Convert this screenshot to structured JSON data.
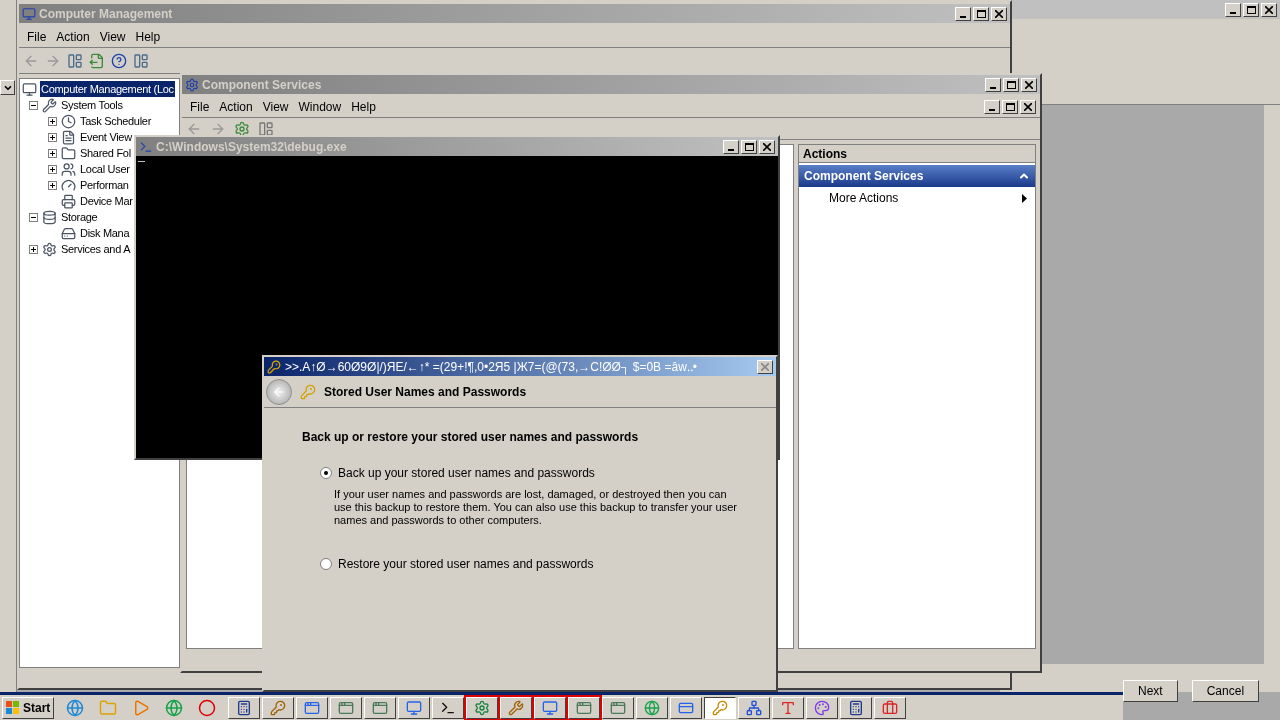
{
  "computer_management": {
    "title": "Computer Management",
    "menu": [
      "File",
      "Action",
      "View",
      "Help"
    ],
    "tree": [
      {
        "label": "Computer Management (Loc",
        "kind": "computer",
        "selected": true,
        "children": [
          {
            "label": "System Tools",
            "kind": "tools",
            "expanded": true,
            "selected": false,
            "children": [
              {
                "label": "Task Scheduler",
                "kind": "clock",
                "expanded": false,
                "selected": false
              },
              {
                "label": "Event View",
                "kind": "log",
                "expanded": false,
                "selected": false
              },
              {
                "label": "Shared Fol",
                "kind": "folder",
                "expanded": false,
                "selected": false
              },
              {
                "label": "Local User",
                "kind": "users",
                "expanded": false,
                "selected": false
              },
              {
                "label": "Performan",
                "kind": "gauge",
                "expanded": false,
                "selected": false
              },
              {
                "label": "Device Mar",
                "kind": "device",
                "selected": false
              }
            ]
          },
          {
            "label": "Storage",
            "kind": "storage",
            "expanded": true,
            "selected": false,
            "children": [
              {
                "label": "Disk Mana",
                "kind": "disk",
                "selected": false
              }
            ]
          },
          {
            "label": "Services and A",
            "kind": "services",
            "expanded": false,
            "selected": false
          }
        ]
      }
    ]
  },
  "component_services": {
    "title": "Component Services",
    "menu": [
      "File",
      "Action",
      "View",
      "Window",
      "Help"
    ],
    "actions": {
      "header": "Actions",
      "section": {
        "label": "Component Services",
        "expanded": true
      },
      "items": [
        "More Actions"
      ]
    }
  },
  "console": {
    "title": "C:\\Windows\\System32\\debug.exe"
  },
  "dialog": {
    "title": ">>.A↑Ø→60Ø9Ø|/)ЯE/←↑* =(29+!¶,0•2Я5 |Ж7=(@(73,→C!ØØ┐  $=0B  =âw‥•",
    "header": "Stored User Names and Passwords",
    "heading": "Back up or restore your stored user names and passwords",
    "options": [
      {
        "label": "Back up your stored user names and passwords",
        "selected": true,
        "description": "If your user names and passwords are lost, damaged, or destroyed then you can use this backup to restore them. You can also use this backup to transfer your user names and passwords to other computers."
      },
      {
        "label": "Restore your stored user names and passwords",
        "selected": false
      }
    ]
  },
  "wizard": {
    "buttons": [
      "Next",
      "Cancel"
    ]
  },
  "taskbar": {
    "start": "Start",
    "items": [
      {
        "kind": "calculator",
        "selected": false,
        "flashing": false
      },
      {
        "kind": "keys",
        "selected": false,
        "flashing": false
      },
      {
        "kind": "app",
        "selected": false,
        "flashing": false
      },
      {
        "kind": "window",
        "selected": false,
        "flashing": false
      },
      {
        "kind": "window",
        "selected": false,
        "flashing": false
      },
      {
        "kind": "monitor",
        "selected": false,
        "flashing": false
      },
      {
        "kind": "console",
        "selected": false,
        "flashing": false
      },
      {
        "kind": "gear",
        "selected": false,
        "flashing": true
      },
      {
        "kind": "tool",
        "selected": false,
        "flashing": true
      },
      {
        "kind": "monitor",
        "selected": false,
        "flashing": true
      },
      {
        "kind": "window",
        "selected": false,
        "flashing": true
      },
      {
        "kind": "window",
        "selected": false,
        "flashing": false
      },
      {
        "kind": "browser",
        "selected": false,
        "flashing": false
      },
      {
        "kind": "card",
        "selected": false,
        "flashing": false
      },
      {
        "kind": "key",
        "selected": true,
        "flashing": false
      },
      {
        "kind": "network",
        "selected": false,
        "flashing": false
      },
      {
        "kind": "font",
        "selected": false,
        "flashing": false
      },
      {
        "kind": "paint",
        "selected": false,
        "flashing": false
      },
      {
        "kind": "calculator",
        "selected": false,
        "flashing": false
      },
      {
        "kind": "toolbox",
        "selected": false,
        "flashing": false
      }
    ]
  }
}
